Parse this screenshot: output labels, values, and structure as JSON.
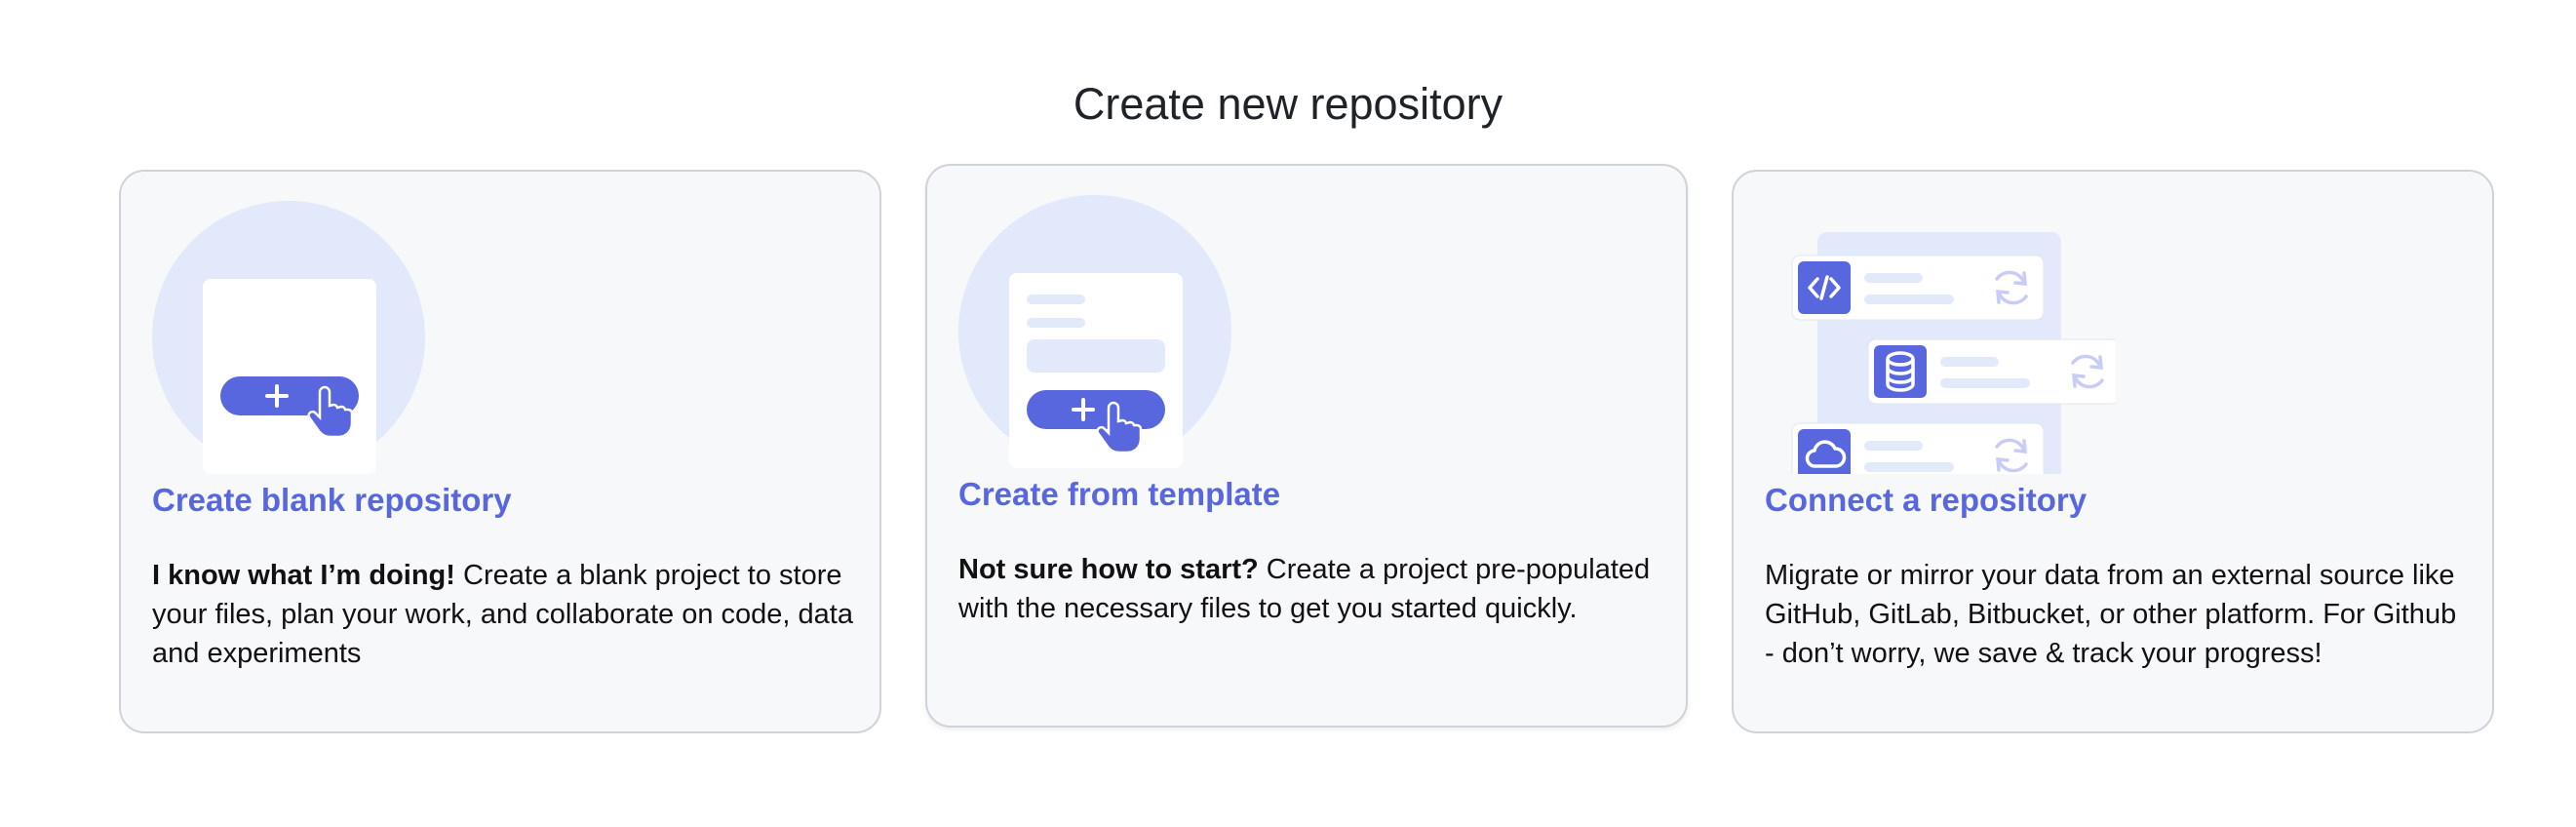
{
  "page": {
    "title": "Create new repository"
  },
  "cards": [
    {
      "title": "Create blank repository",
      "lead": "I know what I’m doing!",
      "body": " Create a blank project to store your files, plan your work, and collaborate on code, data and experiments",
      "illustration": "blank-repo-illustration"
    },
    {
      "title": "Create from template",
      "lead": "Not sure how to start?",
      "body": " Create a project pre-populated with the necessary files to get you started quickly.",
      "illustration": "template-illustration"
    },
    {
      "title": "Connect a repository",
      "lead": "",
      "body": "Migrate or mirror your data from an external source like GitHub, GitLab, Bitbucket, or other platform. For Github - don’t worry, we save & track your progress!",
      "illustration": "connect-illustration"
    }
  ],
  "colors": {
    "accent": "#5867dd",
    "circle": "#e1e9fa",
    "card_bg": "#f7f8fa",
    "card_border": "#cfd2d8",
    "icon_light": "#c7cdf6"
  },
  "icons": [
    "code-icon",
    "database-icon",
    "cloud-icon",
    "sync-icon",
    "plus-icon",
    "hand-pointer-icon"
  ]
}
